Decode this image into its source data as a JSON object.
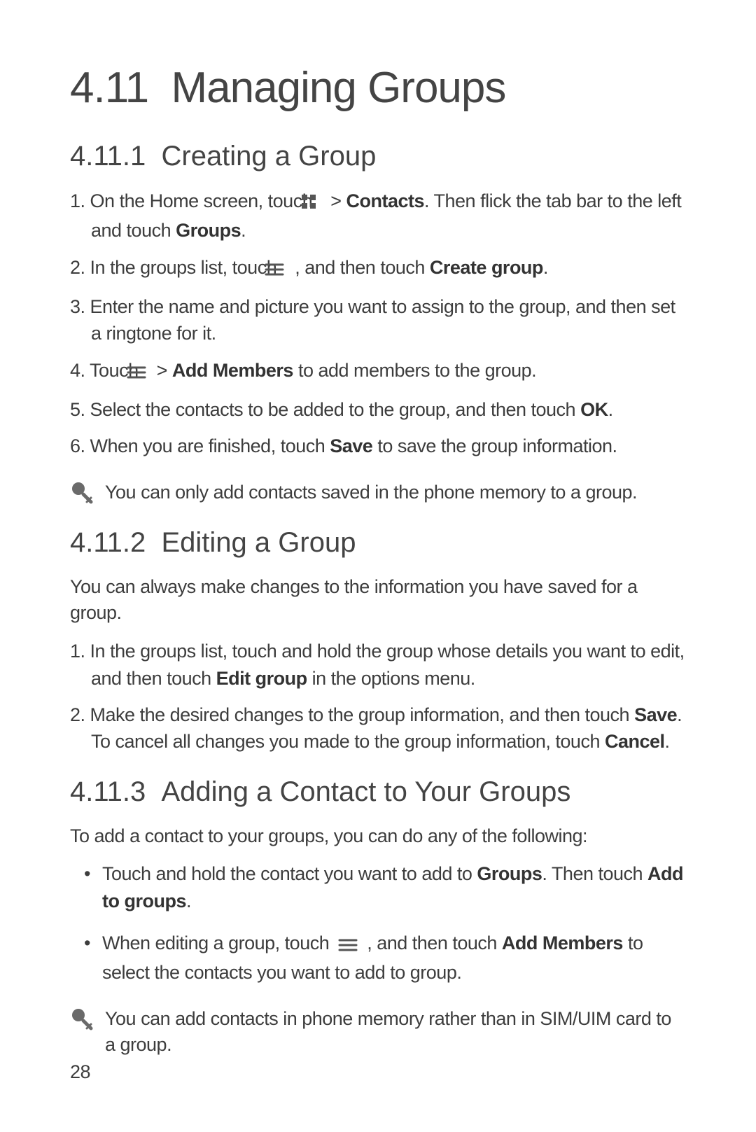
{
  "title": {
    "number": "4.11",
    "text": "Managing Groups"
  },
  "sections": [
    {
      "number": "4.11.1",
      "heading": "Creating a Group",
      "items": [
        {
          "n": "1.",
          "pre": "On the Home screen, touch ",
          "icon": "apps",
          "mid": "  > ",
          "b1": "Contacts",
          "post1": ". Then flick the tab bar to the left and touch ",
          "b2": "Groups",
          "post2": "."
        },
        {
          "n": "2.",
          "pre": "In the groups list, touch ",
          "icon": "menu",
          "mid": " , and then touch ",
          "b1": "Create group",
          "post1": ".",
          "b2": "",
          "post2": ""
        },
        {
          "n": "3.",
          "plain": "Enter the name and picture you want to assign to the group, and then set a ringtone for it."
        },
        {
          "n": "4.",
          "pre": "Touch ",
          "icon": "menu",
          "mid": "  > ",
          "b1": "Add Members",
          "post1": " to add members to the group.",
          "b2": "",
          "post2": ""
        },
        {
          "n": "5.",
          "pre": "Select the contacts to be added to the group, and then touch ",
          "b1": "OK",
          "post1": ".",
          "b2": "",
          "post2": ""
        },
        {
          "n": "6.",
          "pre": "When you are finished, touch ",
          "b1": "Save",
          "post1": " to save the group information.",
          "b2": "",
          "post2": ""
        }
      ],
      "note": "You can only add contacts saved in the phone memory to a group."
    },
    {
      "number": "4.11.2",
      "heading": "Editing a Group",
      "intro": "You can always make changes to the information you have saved for a group.",
      "items": [
        {
          "n": "1.",
          "pre": "In the groups list, touch and hold the group whose details you want to edit, and then touch ",
          "b1": "Edit group",
          "post1": " in the options menu.",
          "b2": "",
          "post2": ""
        },
        {
          "n": "2.",
          "pre": "Make the desired changes to the group information, and then touch ",
          "b1": "Save",
          "post1": ". To cancel all changes you made to the group information, touch ",
          "b2": "Cancel",
          "post2": "."
        }
      ]
    },
    {
      "number": "4.11.3",
      "heading": "Adding a Contact to Your Groups",
      "intro": "To add a contact to your groups, you can do any of the following:",
      "bullets": [
        {
          "pre": "Touch and hold the contact you want to add to ",
          "b1": "Groups",
          "mid": ". Then touch ",
          "b2": "Add to groups",
          "post": "."
        },
        {
          "pre": "When editing a group, touch ",
          "icon": "menu",
          "mid": " , and then touch ",
          "b1": "Add Members",
          "post1": " to select the contacts you want to add to group.",
          "b2": "",
          "post": ""
        }
      ],
      "note": "You can add contacts in phone memory rather than in SIM/UIM card to a group."
    }
  ],
  "page_number": "28"
}
